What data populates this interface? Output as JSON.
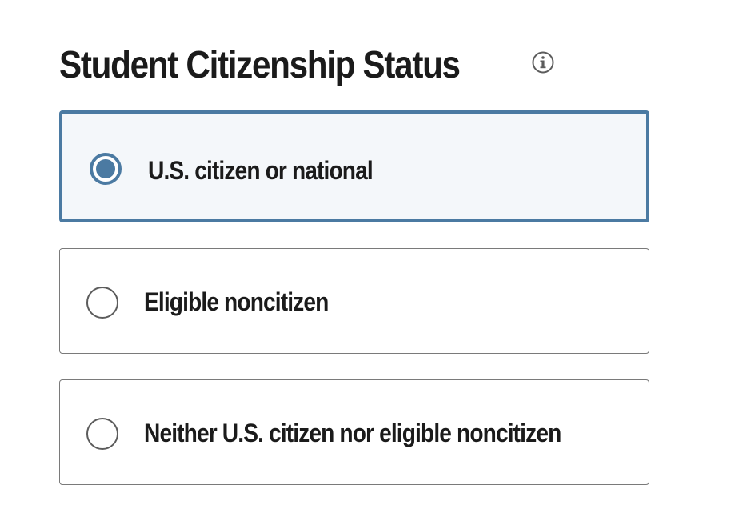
{
  "section": {
    "title": "Student Citizenship Status",
    "info_icon": "info-circle-icon"
  },
  "options": [
    {
      "label": "U.S. citizen or national",
      "selected": true
    },
    {
      "label": "Eligible noncitizen",
      "selected": false
    },
    {
      "label": "Neither U.S. citizen nor eligible noncitizen",
      "selected": false
    }
  ],
  "colors": {
    "accent": "#4b7aa2",
    "selected_background": "#f4f7fa",
    "border": "#7a7a7a",
    "text": "#1b1b1b"
  }
}
